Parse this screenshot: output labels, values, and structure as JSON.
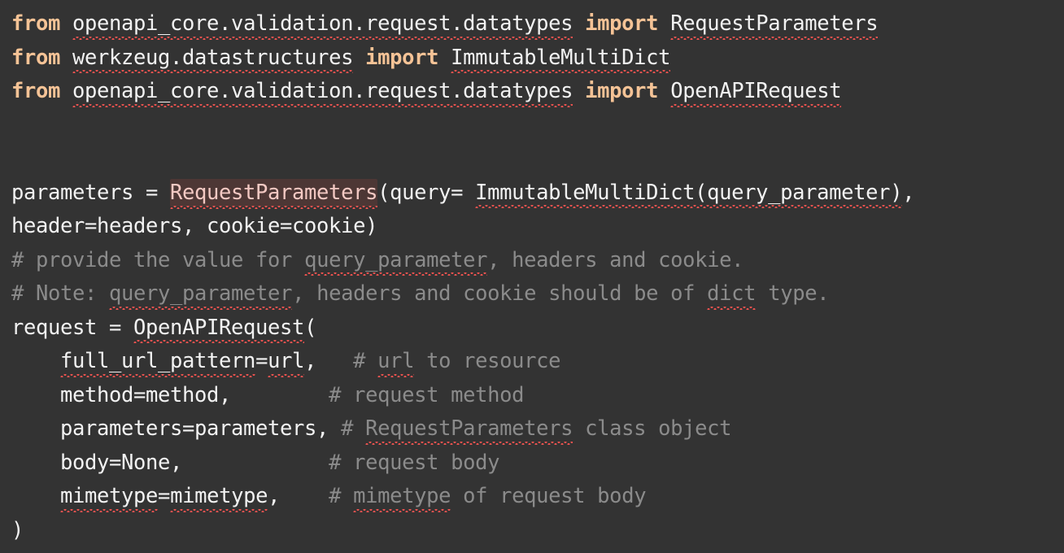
{
  "editor": {
    "language": "python",
    "background_color": "#333333",
    "colors": {
      "foreground": "#f2f2f2",
      "keyword": "#f5c396",
      "comment": "#8b8b8b",
      "error_squiggle": "#e8524f",
      "highlight_background": "#4d3735",
      "highlight_foreground": "#f3c9c3"
    }
  },
  "code": {
    "lines": [
      {
        "index": 1,
        "text": "from openapi_core.validation.request.datatypes import RequestParameters",
        "tokens": [
          {
            "kind": "keyword",
            "text": "from",
            "squiggle": false
          },
          {
            "kind": "plain",
            "text": " ",
            "squiggle": false
          },
          {
            "kind": "plain",
            "text": "openapi_core.validation.request.datatypes",
            "squiggle": true
          },
          {
            "kind": "plain",
            "text": " ",
            "squiggle": false
          },
          {
            "kind": "keyword",
            "text": "import",
            "squiggle": false
          },
          {
            "kind": "plain",
            "text": " ",
            "squiggle": false
          },
          {
            "kind": "plain",
            "text": "RequestParameters",
            "squiggle": true
          }
        ]
      },
      {
        "index": 2,
        "text": "from werkzeug.datastructures import ImmutableMultiDict",
        "tokens": [
          {
            "kind": "keyword",
            "text": "from",
            "squiggle": false
          },
          {
            "kind": "plain",
            "text": " ",
            "squiggle": false
          },
          {
            "kind": "plain",
            "text": "werkzeug.datastructures",
            "squiggle": true
          },
          {
            "kind": "plain",
            "text": " ",
            "squiggle": false
          },
          {
            "kind": "keyword",
            "text": "import",
            "squiggle": false
          },
          {
            "kind": "plain",
            "text": " ",
            "squiggle": false
          },
          {
            "kind": "plain",
            "text": "ImmutableMultiDict",
            "squiggle": true
          }
        ]
      },
      {
        "index": 3,
        "text": "from openapi_core.validation.request.datatypes import OpenAPIRequest",
        "tokens": [
          {
            "kind": "keyword",
            "text": "from",
            "squiggle": false
          },
          {
            "kind": "plain",
            "text": " ",
            "squiggle": false
          },
          {
            "kind": "plain",
            "text": "openapi_core.validation.request.datatypes",
            "squiggle": true
          },
          {
            "kind": "plain",
            "text": " ",
            "squiggle": false
          },
          {
            "kind": "keyword",
            "text": "import",
            "squiggle": false
          },
          {
            "kind": "plain",
            "text": " ",
            "squiggle": false
          },
          {
            "kind": "plain",
            "text": "OpenAPIRequest",
            "squiggle": true
          }
        ]
      },
      {
        "index": 4,
        "text": "",
        "tokens": []
      },
      {
        "index": 5,
        "text": "",
        "tokens": []
      },
      {
        "index": 6,
        "text": "parameters = RequestParameters(query= ImmutableMultiDict(query_parameter),",
        "tokens": [
          {
            "kind": "plain",
            "text": "parameters = ",
            "squiggle": false
          },
          {
            "kind": "highlight",
            "text": "RequestParameters",
            "squiggle": true
          },
          {
            "kind": "plain",
            "text": "(query= ",
            "squiggle": false
          },
          {
            "kind": "plain",
            "text": "ImmutableMultiDict(query_parameter)",
            "squiggle": true
          },
          {
            "kind": "plain",
            "text": ",",
            "squiggle": false
          }
        ]
      },
      {
        "index": 7,
        "text": "header=headers, cookie=cookie)",
        "tokens": [
          {
            "kind": "plain",
            "text": "header=headers, cookie=cookie)",
            "squiggle": false
          }
        ]
      },
      {
        "index": 8,
        "text": "# provide the value for query_parameter, headers and cookie.",
        "tokens": [
          {
            "kind": "comment",
            "text": "# provide the value for ",
            "squiggle": false
          },
          {
            "kind": "comment",
            "text": "query_parameter",
            "squiggle": true
          },
          {
            "kind": "comment",
            "text": ", headers and cookie.",
            "squiggle": false
          }
        ]
      },
      {
        "index": 9,
        "text": "# Note: query_parameter, headers and cookie should be of dict type.",
        "tokens": [
          {
            "kind": "comment",
            "text": "# Note: ",
            "squiggle": false
          },
          {
            "kind": "comment",
            "text": "query_parameter",
            "squiggle": true
          },
          {
            "kind": "comment",
            "text": ", headers and cookie should be of ",
            "squiggle": false
          },
          {
            "kind": "comment",
            "text": "dict",
            "squiggle": true
          },
          {
            "kind": "comment",
            "text": " type.",
            "squiggle": false
          }
        ]
      },
      {
        "index": 10,
        "text": "request = OpenAPIRequest(",
        "tokens": [
          {
            "kind": "plain",
            "text": "request = ",
            "squiggle": false
          },
          {
            "kind": "plain",
            "text": "OpenAPIRequest",
            "squiggle": true
          },
          {
            "kind": "plain",
            "text": "(",
            "squiggle": false
          }
        ]
      },
      {
        "index": 11,
        "text": "    full_url_pattern=url,  # url to resource",
        "tokens": [
          {
            "kind": "plain",
            "text": "    ",
            "squiggle": false
          },
          {
            "kind": "plain",
            "text": "full_url_pattern",
            "squiggle": true
          },
          {
            "kind": "plain",
            "text": "=",
            "squiggle": false
          },
          {
            "kind": "plain",
            "text": "url",
            "squiggle": true
          },
          {
            "kind": "plain",
            "text": ",   ",
            "squiggle": false
          },
          {
            "kind": "comment",
            "text": "# ",
            "squiggle": false
          },
          {
            "kind": "comment",
            "text": "url",
            "squiggle": true
          },
          {
            "kind": "comment",
            "text": " to resource",
            "squiggle": false
          }
        ]
      },
      {
        "index": 12,
        "text": "    method=method,         # request method",
        "tokens": [
          {
            "kind": "plain",
            "text": "    method=method,        ",
            "squiggle": false
          },
          {
            "kind": "comment",
            "text": "# request method",
            "squiggle": false
          }
        ]
      },
      {
        "index": 13,
        "text": "    parameters=parameters, # RequestParameters class object",
        "tokens": [
          {
            "kind": "plain",
            "text": "    parameters=parameters, ",
            "squiggle": false
          },
          {
            "kind": "comment",
            "text": "# ",
            "squiggle": false
          },
          {
            "kind": "comment",
            "text": "RequestParameters",
            "squiggle": true
          },
          {
            "kind": "comment",
            "text": " class object",
            "squiggle": false
          }
        ]
      },
      {
        "index": 14,
        "text": "    body=None,             # request body",
        "tokens": [
          {
            "kind": "plain",
            "text": "    body=None,            ",
            "squiggle": false
          },
          {
            "kind": "comment",
            "text": "# request body",
            "squiggle": false
          }
        ]
      },
      {
        "index": 15,
        "text": "    mimetype=mimetype,     # mimetype of request body",
        "tokens": [
          {
            "kind": "plain",
            "text": "    ",
            "squiggle": false
          },
          {
            "kind": "plain",
            "text": "mimetype",
            "squiggle": true
          },
          {
            "kind": "plain",
            "text": "=",
            "squiggle": false
          },
          {
            "kind": "plain",
            "text": "mimetype",
            "squiggle": true
          },
          {
            "kind": "plain",
            "text": ",    ",
            "squiggle": false
          },
          {
            "kind": "comment",
            "text": "# ",
            "squiggle": false
          },
          {
            "kind": "comment",
            "text": "mimetype",
            "squiggle": true
          },
          {
            "kind": "comment",
            "text": " of request body",
            "squiggle": false
          }
        ]
      },
      {
        "index": 16,
        "text": ")",
        "tokens": [
          {
            "kind": "plain",
            "text": ")",
            "squiggle": false
          }
        ]
      }
    ]
  }
}
